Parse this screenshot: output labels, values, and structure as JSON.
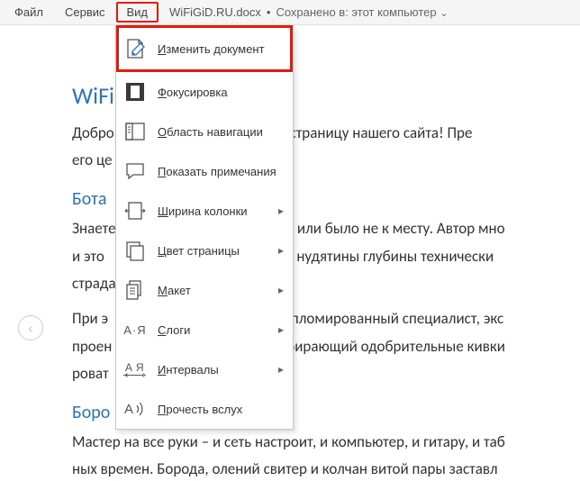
{
  "menubar": {
    "items": [
      {
        "label": "Файл"
      },
      {
        "label": "Сервис"
      },
      {
        "label": "Вид"
      }
    ],
    "doc_title": "WiFiGiD.RU.docx",
    "save_sep": "•",
    "save_status": "Сохранено в: этот компьютер"
  },
  "dropdown": {
    "items": [
      {
        "label": "Изменить документ",
        "underline_index": 0,
        "icon": "edit-doc-icon",
        "submenu": false
      },
      {
        "label": "Фокусировка",
        "underline_index": 0,
        "icon": "focus-icon",
        "submenu": false
      },
      {
        "label": "Область навигации",
        "underline_index": 0,
        "icon": "nav-pane-icon",
        "submenu": false
      },
      {
        "label": "Показать примечания",
        "underline_index": 0,
        "icon": "comments-icon",
        "submenu": false
      },
      {
        "label": "Ширина колонки",
        "underline_index": 0,
        "icon": "column-width-icon",
        "submenu": true
      },
      {
        "label": "Цвет страницы",
        "underline_index": 0,
        "icon": "page-color-icon",
        "submenu": true
      },
      {
        "label": "Макет",
        "underline_index": 0,
        "icon": "layout-icon",
        "submenu": true
      },
      {
        "label": "Слоги",
        "underline_index": 0,
        "icon": "syllables-icon",
        "submenu": true
      },
      {
        "label": "Интервалы",
        "underline_index": 0,
        "icon": "spacing-icon",
        "submenu": true
      },
      {
        "label": "Прочесть вслух",
        "underline_index": 0,
        "icon": "read-aloud-icon",
        "submenu": false
      }
    ]
  },
  "doc": {
    "h1": "WiFiGiD.RU",
    "p1": "Добро пожаловать на секретную страницу нашего сайта! Пре",
    "p1b": "его це",
    "h2a": "Бота",
    "p2a": "Знаете",
    "p2a_tail": "жно или было не к месту. Автор мно",
    "p2b": "и это",
    "p2b_tail": "га и нудятины глубины технически",
    "p2c": "страда",
    "p3a": "При э",
    "p3a_tail": "Дипломированный специалист, экс",
    "p3b": "проен",
    "p3b_tail": "собирающий одобрительные кивки",
    "p3c": "роват",
    "h2b": "Боро",
    "p4": "Мастер на все руки – и сеть настроит, и компьютер, и гитару, и таб",
    "p5": "ных времен. Борода, олений свитер и колчан витой пары заставл"
  }
}
